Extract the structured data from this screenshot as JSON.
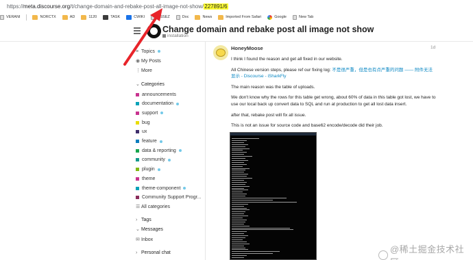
{
  "browser": {
    "url_prefix": "https://",
    "url_host": "meta.discourse.org",
    "url_path": "/t/change-domain-and-rebake-post-all-image-not-show/",
    "url_highlight": "227891/6",
    "bookmarks": [
      {
        "label": "VERANI",
        "icon": "page"
      },
      {
        "label": "NORCTX",
        "icon": "folder"
      },
      {
        "label": "AD",
        "icon": "folder"
      },
      {
        "label": "1120",
        "icon": "folder"
      },
      {
        "label": "TASK",
        "icon": "dark"
      },
      {
        "label": "CWIKI",
        "icon": "blue"
      },
      {
        "label": "OSSEZ",
        "icon": "page"
      },
      {
        "label": "Doc",
        "icon": "page"
      },
      {
        "label": "News",
        "icon": "folder"
      },
      {
        "label": "Imported From Safari",
        "icon": "folder"
      },
      {
        "label": "Google",
        "icon": "goog"
      },
      {
        "label": "New Tab",
        "icon": "page"
      }
    ]
  },
  "topic": {
    "title": "Change domain and rebake post all image not show",
    "category": "installation"
  },
  "sidebar": {
    "nav": [
      {
        "label": "Topics",
        "icon": "≡",
        "dot": true
      },
      {
        "label": "My Posts",
        "icon": "◉",
        "dot": false
      },
      {
        "label": "More",
        "icon": "⋮",
        "dot": false
      }
    ],
    "categories_heading": "Categories",
    "categories": [
      {
        "label": "announcements",
        "color": "#c8338f",
        "dot": false
      },
      {
        "label": "documentation",
        "color": "#0aa2b8",
        "dot": true
      },
      {
        "label": "support",
        "color": "#c8338f",
        "dot": true
      },
      {
        "label": "bug",
        "color": "#e9dd00",
        "dot": false
      },
      {
        "label": "ux",
        "color": "#3f2e6b",
        "dot": false
      },
      {
        "label": "feature",
        "color": "#0b7dbe",
        "dot": true
      },
      {
        "label": "data & reporting",
        "color": "#18a54d",
        "dot": true
      },
      {
        "label": "community",
        "color": "#14998c",
        "dot": true
      },
      {
        "label": "plugin",
        "color": "#82b814",
        "dot": true
      },
      {
        "label": "theme",
        "color": "#c8338f",
        "dot": false
      },
      {
        "label": "theme-component",
        "color": "#0aa2b8",
        "dot": true
      },
      {
        "label": "Community Support Progr...",
        "color": "#8a2d5c",
        "dot": false
      },
      {
        "label": "All categories",
        "color": "",
        "dot": false
      }
    ],
    "tags_heading": "Tags",
    "messages_heading": "Messages",
    "messages_items": [
      {
        "label": "Inbox",
        "icon": "✉"
      }
    ],
    "personal_chat_heading": "Personal chat"
  },
  "post": {
    "author": "HoneyMoose",
    "date": "1d",
    "p1": "I think I found the reason and get all fixed in our website.",
    "p2_text": "All Chinese version steps, please ref our fixing log: ",
    "p2_link": "不是很严重，但是也有点严重的问题 —— 附件无法显示 - Discourse - iSharkFly",
    "p3": "The main reason was the table of uploads.",
    "p4": "We don't know why the rows for this table get wrong, about 60% of data in this table got lost, we have to use our local back up convert data to SQL and run at production to get all lost data insert.",
    "p5": "after that, rebake post will fix all issue.",
    "p6": "This is not an issue for source code and base62 encode/decode did their job."
  },
  "watermark": {
    "text": "@稀土掘金技术社区"
  },
  "colors": {
    "link": "#0a87c3",
    "annotation_arrow": "#e8242a",
    "url_highlight": "#ffff33",
    "unread_dot": "#74c9e8"
  }
}
